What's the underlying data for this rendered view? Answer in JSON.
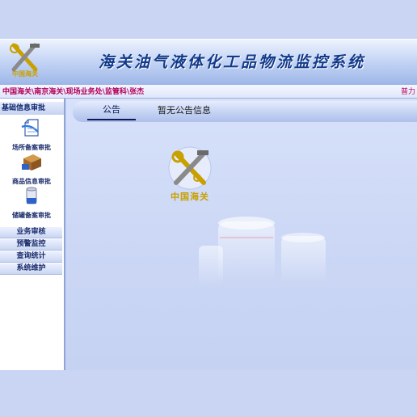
{
  "header": {
    "logo_text": "中国海关",
    "system_title": "海关油气液体化工品物流监控系统"
  },
  "breadcrumb": {
    "path": "中国海关\\南京海关\\现场业务处\\监管科\\张杰",
    "right_text": "普力"
  },
  "sidebar": {
    "section_title": "基础信息审批",
    "tiles": [
      {
        "label": "场所备案审批",
        "icon": "document-check-icon"
      },
      {
        "label": "商品信息审批",
        "icon": "cargo-box-icon"
      },
      {
        "label": "储罐备案审批",
        "icon": "storage-tank-icon"
      }
    ],
    "menu": [
      "业务审核",
      "预警监控",
      "查询统计",
      "系统维护"
    ]
  },
  "main": {
    "notice_tab_label": "公告",
    "notice_text": "暂无公告信息",
    "center_logo_text": "中国海关"
  },
  "colors": {
    "accent": "#123a8a",
    "breadcrumb": "#b4005a",
    "logo_gold": "#c8a000"
  }
}
